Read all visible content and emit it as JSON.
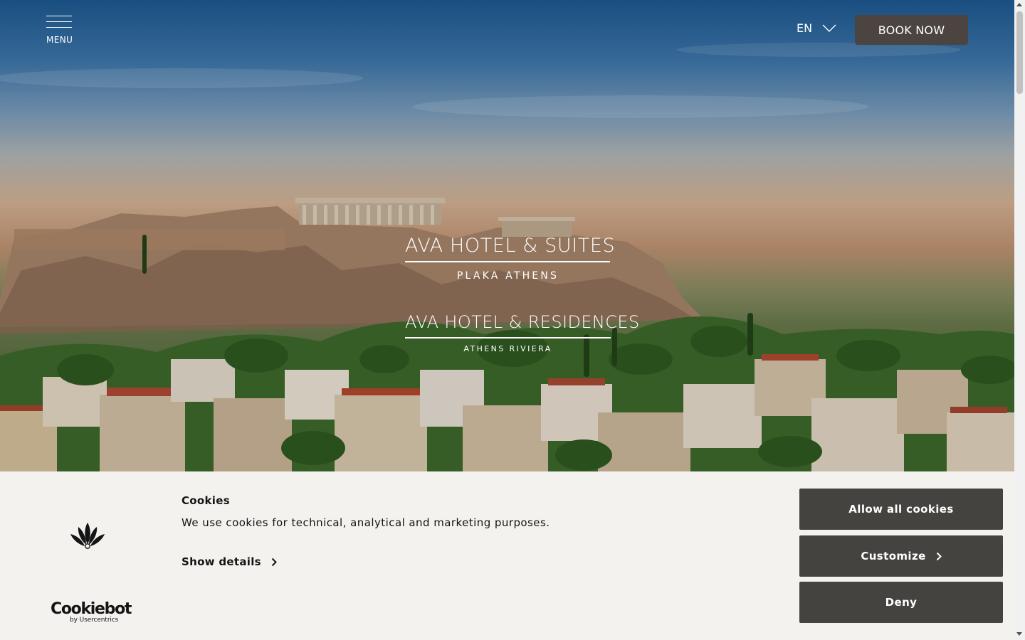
{
  "header": {
    "menu_label": "MENU",
    "language": "EN",
    "book_now_label": "BOOK NOW"
  },
  "hero": {
    "hotels": [
      {
        "name": "AVA HOTEL & SUITES",
        "location": "PLAKA ATHENS"
      },
      {
        "name": "AVA HOTEL & RESIDENCES",
        "location": "ATHENS RIVIERA"
      }
    ]
  },
  "cookie_banner": {
    "title": "Cookies",
    "text": "We use cookies for technical, analytical and marketing purposes.",
    "show_details_label": "Show details",
    "brand": {
      "name": "Cookiebot",
      "by": "by Usercentrics"
    },
    "buttons": {
      "allow_all": "Allow all cookies",
      "customize": "Customize",
      "deny": "Deny"
    }
  },
  "colors": {
    "book_button": "#4b4440",
    "cookie_button": "#454340",
    "cookie_background": "#f3f2ef"
  },
  "icons": {
    "menu": "hamburger-icon",
    "language": "chevron-down-icon",
    "details": "chevron-right-icon",
    "brand": "cookiebot-flower-icon"
  }
}
